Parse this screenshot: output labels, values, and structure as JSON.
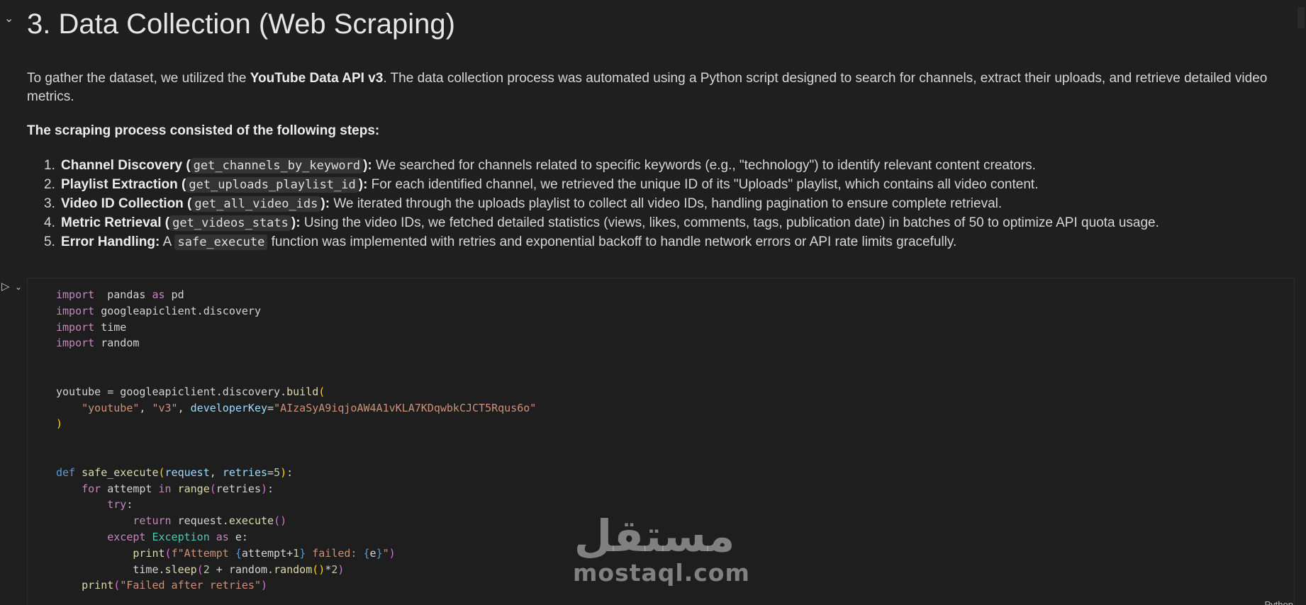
{
  "heading": {
    "title": "3. Data Collection (Web Scraping)"
  },
  "intro": {
    "before": "To gather the dataset, we utilized the ",
    "api": "YouTube Data API v3",
    "after": ". The data collection process was automated using a Python script designed to search for channels, extract their uploads, and retrieve detailed video metrics."
  },
  "steps_title": "The scraping process consisted of the following steps:",
  "steps": [
    {
      "num": "1.",
      "title_before": "Channel Discovery (",
      "code": "get_channels_by_keyword",
      "title_after": "):",
      "text": " We searched for channels related to specific keywords (e.g., \"technology\") to identify relevant content creators."
    },
    {
      "num": "2.",
      "title_before": "Playlist Extraction (",
      "code": "get_uploads_playlist_id",
      "title_after": "):",
      "text": " For each identified channel, we retrieved the unique ID of its \"Uploads\" playlist, which contains all video content."
    },
    {
      "num": "3.",
      "title_before": "Video ID Collection (",
      "code": "get_all_video_ids",
      "title_after": "):",
      "text": " We iterated through the uploads playlist to collect all video IDs, handling pagination to ensure complete retrieval."
    },
    {
      "num": "4.",
      "title_before": "Metric Retrieval (",
      "code": "get_videos_stats",
      "title_after": "):",
      "text": " Using the video IDs, we fetched detailed statistics (views, likes, comments, tags, publication date) in batches of 50 to optimize API quota usage."
    },
    {
      "num": "5.",
      "title_before": "Error Handling:",
      "pre": " A ",
      "code": "safe_execute",
      "text": " function was implemented with retries and exponential backoff to handle network errors or API rate limits gracefully."
    }
  ],
  "code": {
    "language": "Python",
    "lines": [
      [
        [
          "kw",
          "import"
        ],
        [
          "",
          "  pandas "
        ],
        [
          "kw",
          "as"
        ],
        [
          "",
          " pd"
        ]
      ],
      [
        [
          "kw",
          "import"
        ],
        [
          "",
          " googleapiclient.discovery"
        ]
      ],
      [
        [
          "kw",
          "import"
        ],
        [
          "",
          " time"
        ]
      ],
      [
        [
          "kw",
          "import"
        ],
        [
          "",
          " random"
        ]
      ],
      [],
      [],
      [
        [
          "",
          "youtube = googleapiclient.discovery."
        ],
        [
          "fn",
          "build"
        ],
        [
          "br",
          "("
        ]
      ],
      [
        [
          "",
          "    "
        ],
        [
          "str",
          "\"youtube\""
        ],
        [
          "",
          ", "
        ],
        [
          "str",
          "\"v3\""
        ],
        [
          "",
          ", "
        ],
        [
          "param",
          "developerKey"
        ],
        [
          "",
          "="
        ],
        [
          "str",
          "\"AIzaSyA9iqjoAW4A1vKLA7KDqwbkCJCT5Rqus6o\""
        ]
      ],
      [
        [
          "br",
          ")"
        ]
      ],
      [],
      [],
      [
        [
          "kw2",
          "def"
        ],
        [
          "",
          " "
        ],
        [
          "fn",
          "safe_execute"
        ],
        [
          "br",
          "("
        ],
        [
          "param",
          "request"
        ],
        [
          "",
          ", "
        ],
        [
          "param",
          "retries"
        ],
        [
          "",
          "="
        ],
        [
          "num2",
          "5"
        ],
        [
          "br",
          ")"
        ],
        [
          "",
          ":"
        ]
      ],
      [
        [
          "",
          "    "
        ],
        [
          "kw",
          "for"
        ],
        [
          "",
          " attempt "
        ],
        [
          "kw",
          "in"
        ],
        [
          "",
          " "
        ],
        [
          "fn",
          "range"
        ],
        [
          "br2",
          "("
        ],
        [
          "",
          "retries"
        ],
        [
          "br2",
          ")"
        ],
        [
          "",
          ":"
        ]
      ],
      [
        [
          "",
          "        "
        ],
        [
          "kw",
          "try"
        ],
        [
          "",
          ":"
        ]
      ],
      [
        [
          "",
          "            "
        ],
        [
          "kw",
          "return"
        ],
        [
          "",
          " request."
        ],
        [
          "fn",
          "execute"
        ],
        [
          "br2",
          "()"
        ]
      ],
      [
        [
          "",
          "        "
        ],
        [
          "kw",
          "except"
        ],
        [
          "",
          " "
        ],
        [
          "cls",
          "Exception"
        ],
        [
          "",
          " "
        ],
        [
          "kw",
          "as"
        ],
        [
          "",
          " e:"
        ]
      ],
      [
        [
          "",
          "            "
        ],
        [
          "fn",
          "print"
        ],
        [
          "br2",
          "("
        ],
        [
          "str",
          "f\"Attempt "
        ],
        [
          "kw2",
          "{"
        ],
        [
          "",
          "attempt+"
        ],
        [
          "num2",
          "1"
        ],
        [
          "kw2",
          "}"
        ],
        [
          "str",
          " failed: "
        ],
        [
          "kw2",
          "{"
        ],
        [
          "",
          "e"
        ],
        [
          "kw2",
          "}"
        ],
        [
          "str",
          "\""
        ],
        [
          "br2",
          ")"
        ]
      ],
      [
        [
          "",
          "            time."
        ],
        [
          "fn",
          "sleep"
        ],
        [
          "br2",
          "("
        ],
        [
          "num2",
          "2"
        ],
        [
          "",
          " + random."
        ],
        [
          "fn",
          "random"
        ],
        [
          "br",
          "()"
        ],
        [
          "",
          "*"
        ],
        [
          "num2",
          "2"
        ],
        [
          "br2",
          ")"
        ]
      ],
      [
        [
          "",
          "    "
        ],
        [
          "fn",
          "print"
        ],
        [
          "br2",
          "("
        ],
        [
          "str",
          "\"Failed after retries\""
        ],
        [
          "br2",
          ")"
        ]
      ]
    ]
  },
  "watermark": {
    "arabic": "مستقل",
    "latin": "mostaql.com"
  },
  "icons": {
    "collapse": "chevron-down-icon",
    "run": "play-icon"
  }
}
